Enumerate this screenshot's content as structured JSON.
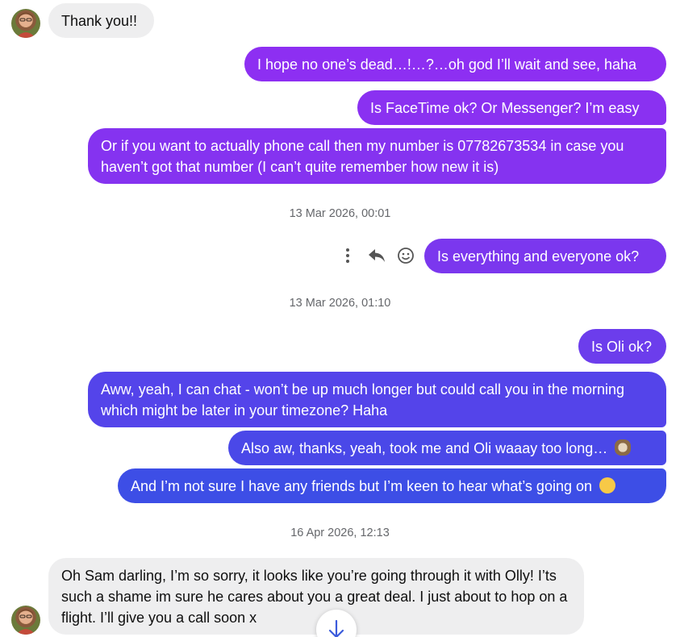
{
  "messages": [
    {
      "id": "m1",
      "dir": "in",
      "text": "Thank you!!"
    },
    {
      "id": "m2",
      "dir": "out",
      "text": "I hope no one’s dead…!…?…oh god I’ll wait and see, haha"
    },
    {
      "id": "m3",
      "dir": "out",
      "text": "Is FaceTime ok? Or Messenger? I’m easy"
    },
    {
      "id": "m4",
      "dir": "out",
      "text": "Or if you want to actually phone call then my number is 07782673534 in case you haven’t got that number (I can’t quite remember how new it is)"
    },
    {
      "id": "m5",
      "dir": "out",
      "text": "Is everything and everyone ok?"
    },
    {
      "id": "m6",
      "dir": "out",
      "text": "Is Oli ok?"
    },
    {
      "id": "m7",
      "dir": "out",
      "text": "Aww, yeah, I can chat - won’t be up much longer but could call you in the morning which might be later in your timezone? Haha"
    },
    {
      "id": "m8",
      "dir": "out",
      "text": "Also aw, thanks, yeah, took me and Oli waaay too long…",
      "emoji": "sloth"
    },
    {
      "id": "m9",
      "dir": "out",
      "text": "And I’m not sure I have any friends but I’m keen to hear what’s going on",
      "emoji": "grinning-sweat"
    },
    {
      "id": "m10",
      "dir": "in",
      "text": "Oh Sam darling, I’m so sorry, it looks like you’re going through it with Olly! I’ts such a shame im sure he cares about you a great deal. I just about to hop on a flight. I’ll give you a call soon x"
    }
  ],
  "timestamps": [
    "13 Mar 2026, 00:01",
    "13 Mar 2026, 01:10",
    "16 Apr 2026, 12:13"
  ],
  "hover_actions": [
    "more-icon",
    "reply-icon",
    "react-icon"
  ],
  "scroll_button": {
    "icon": "arrow-down-icon"
  },
  "colors": {
    "out_top": "#8d2ff2",
    "out_bottom": "#3d4ee6",
    "incoming_bg": "#eeeeef",
    "timestamp": "#65676b"
  }
}
